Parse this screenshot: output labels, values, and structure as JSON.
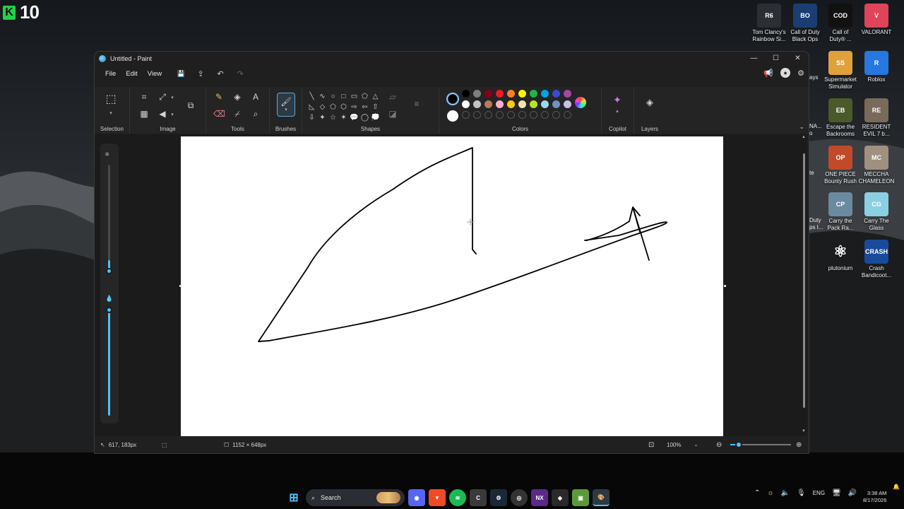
{
  "overlay": {
    "badge_letter": "K",
    "counter": "10"
  },
  "desktop_icons": [
    {
      "label": "Tom Clancy's\nRainbow Si...",
      "color": "#2b2f35",
      "glyph": "R6"
    },
    {
      "label": "Call of Duty\nBlack Ops",
      "color": "#1c3d74",
      "glyph": "BO"
    },
    {
      "label": "Call of\nDuty® ...",
      "color": "#111111",
      "glyph": "COD"
    },
    {
      "label": "VALORANT",
      "color": "#e04458",
      "glyph": "V"
    },
    {
      "label": "Supermarket\nSimulator",
      "color": "#e0a13c",
      "glyph": "SS"
    },
    {
      "label": "Roblox",
      "color": "#2478e0",
      "glyph": "R"
    },
    {
      "label": "Escape the\nBackrooms",
      "color": "#4a5a2a",
      "glyph": "EB"
    },
    {
      "label": "RESIDENT\nEVIL 7 b...",
      "color": "#7a6a5a",
      "glyph": "RE"
    },
    {
      "label": "ONE PIECE\nBounty Rush",
      "color": "#c04a2a",
      "glyph": "OP"
    },
    {
      "label": "MECCHA\nCHAMELEON",
      "color": "#a09080",
      "glyph": "MC"
    },
    {
      "label": "Carry the\nPack Ra...",
      "color": "#6a8aa0",
      "glyph": "CP"
    },
    {
      "label": "Carry The\nGlass",
      "color": "#8ad0e0",
      "glyph": "CG"
    },
    {
      "label": "plutonium",
      "color": "transparent",
      "glyph": "⚛"
    },
    {
      "label": "Crash\nBandicoot...",
      "color": "#1a4a9a",
      "glyph": "CRASH"
    }
  ],
  "partial_labels": [
    "ays",
    "NA...",
    "o",
    "te",
    "Duty",
    "ps I..."
  ],
  "window": {
    "title": "Untitled - Paint",
    "controls": {
      "minimize": "—",
      "maximize": "☐",
      "close": "✕"
    }
  },
  "menu": {
    "file": "File",
    "edit": "Edit",
    "view": "View"
  },
  "quick_actions": {
    "save": "💾",
    "share": "⇪",
    "undo": "↶",
    "redo": "↷"
  },
  "ribbon": {
    "selection": "Selection",
    "image": "Image",
    "tools": "Tools",
    "brushes": "Brushes",
    "shapes": "Shapes",
    "colors": "Colors",
    "copilot": "Copilot",
    "layers": "Layers"
  },
  "shape_glyphs": [
    "╲",
    "∿",
    "○",
    "□",
    "▭",
    "⬠",
    "△",
    "◺",
    "◇",
    "⬠",
    "⬡",
    "⇨",
    "⇦",
    "⇧",
    "⇩",
    "✦",
    "☆",
    "✶",
    "💬",
    "◯",
    "💭"
  ],
  "colors": {
    "primary": "#000000",
    "secondary": "#ffffff",
    "palette_row1": [
      "#000000",
      "#7f7f7f",
      "#880015",
      "#ed1c24",
      "#ff7f27",
      "#fff200",
      "#22b14c",
      "#00a2e8",
      "#3f48cc",
      "#a349a4"
    ],
    "palette_row2": [
      "#ffffff",
      "#c3c3c3",
      "#b97a57",
      "#ffaec9",
      "#ffc90e",
      "#efe4b0",
      "#b5e61d",
      "#99d9ea",
      "#7092be",
      "#c8bfe7"
    ]
  },
  "status": {
    "cursor_pos": "617, 183px",
    "canvas_size": "1152 × 648px",
    "zoom": "100%"
  },
  "taskbar": {
    "search_label": "Search",
    "language": "ENG",
    "time": "3:38 AM",
    "date": "8/17/2026"
  }
}
